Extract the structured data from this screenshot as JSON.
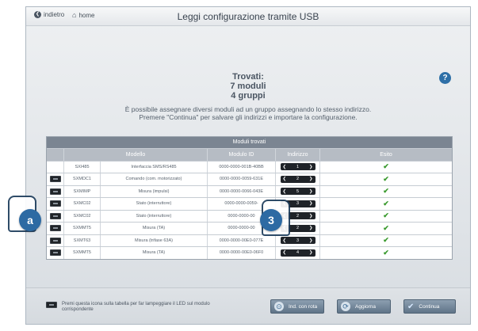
{
  "header": {
    "back_label": "indietro",
    "home_label": "home",
    "title": "Leggi configurazione tramite USB"
  },
  "summary": {
    "line1": "Trovati:",
    "line2": "7 moduli",
    "line3": "4 gruppi"
  },
  "help_symbol": "?",
  "description": {
    "line1": "È possibile assegnare diversi moduli ad un gruppo assegnando lo stesso indirizzo.",
    "line2": "Premere \"Continua\" per salvare gli indirizzi e importare la configurazione."
  },
  "table": {
    "title": "Moduli trovati",
    "columns": [
      "Modello",
      "Modulo ID",
      "Indirizzo",
      "Esito"
    ],
    "rows": [
      {
        "model": "SXI485",
        "desc": "Interfaccia SMS/RS485",
        "id": "0000-0000-001B-40BB",
        "addr": "1",
        "led": false
      },
      {
        "model": "SXMDC1",
        "desc": "Comando (com. motorizzato)",
        "id": "0000-0000-0059-631E",
        "addr": "2",
        "led": true
      },
      {
        "model": "SXMIMP",
        "desc": "Misura (impulsi)",
        "id": "0000-0000-0066-043E",
        "addr": "5",
        "led": true
      },
      {
        "model": "SXMC02",
        "desc": "Stato (interruttore)",
        "id": "0000-0000-0059-",
        "addr": "3",
        "led": true
      },
      {
        "model": "SXMC02",
        "desc": "Stato (interruttore)",
        "id": "0000-0000-00",
        "addr": "2",
        "led": true
      },
      {
        "model": "SXMMT5",
        "desc": "Misura (TA)",
        "id": "0000-0000-00",
        "addr": "2",
        "led": true
      },
      {
        "model": "SXMT63",
        "desc": "Misura (trifase 63A)",
        "id": "0000-0000-00E0-077E",
        "addr": "3",
        "led": true
      },
      {
        "model": "SXMMT5",
        "desc": "Misura (TA)",
        "id": "0000-0000-00E0-06F0",
        "addr": "4",
        "led": true
      }
    ]
  },
  "legend_text": "Premi questa icona sulla tabella per far lampeggiare il LED sul modulo corrispondente",
  "buttons": {
    "ind_label": "Ind. con rota",
    "refresh_label": "Aggiorna",
    "continue_label": "Continua"
  },
  "callouts": {
    "a": "a",
    "b": "3"
  },
  "colors": {
    "accent": "#2d6aa3",
    "ok": "#3a9a2e"
  }
}
